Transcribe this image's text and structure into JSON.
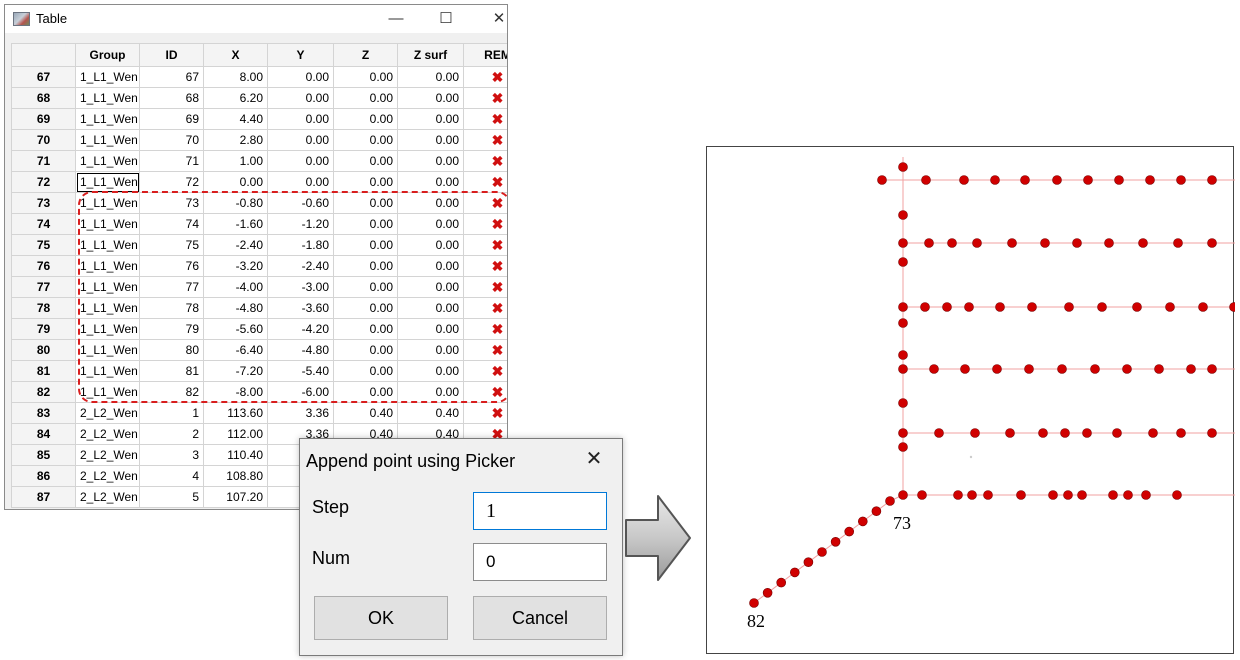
{
  "window": {
    "title": "Table",
    "minimize_glyph": "—",
    "maximize_glyph": "☐",
    "close_glyph": "✕",
    "icon": "app-icon"
  },
  "table": {
    "columns": [
      "",
      "Group",
      "ID",
      "X",
      "Y",
      "Z",
      "Z surf",
      "REM"
    ],
    "rows": [
      {
        "row": "67",
        "group": "1_L1_Wen",
        "id": "67",
        "x": "8.00",
        "y": "0.00",
        "z": "0.00",
        "zsurf": "0.00",
        "rem": "✖"
      },
      {
        "row": "68",
        "group": "1_L1_Wen",
        "id": "68",
        "x": "6.20",
        "y": "0.00",
        "z": "0.00",
        "zsurf": "0.00",
        "rem": "✖"
      },
      {
        "row": "69",
        "group": "1_L1_Wen",
        "id": "69",
        "x": "4.40",
        "y": "0.00",
        "z": "0.00",
        "zsurf": "0.00",
        "rem": "✖"
      },
      {
        "row": "70",
        "group": "1_L1_Wen",
        "id": "70",
        "x": "2.80",
        "y": "0.00",
        "z": "0.00",
        "zsurf": "0.00",
        "rem": "✖"
      },
      {
        "row": "71",
        "group": "1_L1_Wen",
        "id": "71",
        "x": "1.00",
        "y": "0.00",
        "z": "0.00",
        "zsurf": "0.00",
        "rem": "✖"
      },
      {
        "row": "72",
        "group": "1_L1_Wen",
        "id": "72",
        "x": "0.00",
        "y": "0.00",
        "z": "0.00",
        "zsurf": "0.00",
        "rem": "✖"
      },
      {
        "row": "73",
        "group": "1_L1_Wen",
        "id": "73",
        "x": "-0.80",
        "y": "-0.60",
        "z": "0.00",
        "zsurf": "0.00",
        "rem": "✖"
      },
      {
        "row": "74",
        "group": "1_L1_Wen",
        "id": "74",
        "x": "-1.60",
        "y": "-1.20",
        "z": "0.00",
        "zsurf": "0.00",
        "rem": "✖"
      },
      {
        "row": "75",
        "group": "1_L1_Wen",
        "id": "75",
        "x": "-2.40",
        "y": "-1.80",
        "z": "0.00",
        "zsurf": "0.00",
        "rem": "✖"
      },
      {
        "row": "76",
        "group": "1_L1_Wen",
        "id": "76",
        "x": "-3.20",
        "y": "-2.40",
        "z": "0.00",
        "zsurf": "0.00",
        "rem": "✖"
      },
      {
        "row": "77",
        "group": "1_L1_Wen",
        "id": "77",
        "x": "-4.00",
        "y": "-3.00",
        "z": "0.00",
        "zsurf": "0.00",
        "rem": "✖"
      },
      {
        "row": "78",
        "group": "1_L1_Wen",
        "id": "78",
        "x": "-4.80",
        "y": "-3.60",
        "z": "0.00",
        "zsurf": "0.00",
        "rem": "✖"
      },
      {
        "row": "79",
        "group": "1_L1_Wen",
        "id": "79",
        "x": "-5.60",
        "y": "-4.20",
        "z": "0.00",
        "zsurf": "0.00",
        "rem": "✖"
      },
      {
        "row": "80",
        "group": "1_L1_Wen",
        "id": "80",
        "x": "-6.40",
        "y": "-4.80",
        "z": "0.00",
        "zsurf": "0.00",
        "rem": "✖"
      },
      {
        "row": "81",
        "group": "1_L1_Wen",
        "id": "81",
        "x": "-7.20",
        "y": "-5.40",
        "z": "0.00",
        "zsurf": "0.00",
        "rem": "✖"
      },
      {
        "row": "82",
        "group": "1_L1_Wen",
        "id": "82",
        "x": "-8.00",
        "y": "-6.00",
        "z": "0.00",
        "zsurf": "0.00",
        "rem": "✖"
      },
      {
        "row": "83",
        "group": "2_L2_Wen",
        "id": "1",
        "x": "113.60",
        "y": "3.36",
        "z": "0.40",
        "zsurf": "0.40",
        "rem": "✖"
      },
      {
        "row": "84",
        "group": "2_L2_Wen",
        "id": "2",
        "x": "112.00",
        "y": "3.36",
        "z": "0.40",
        "zsurf": "0.40",
        "rem": "✖"
      },
      {
        "row": "85",
        "group": "2_L2_Wen",
        "id": "3",
        "x": "110.40",
        "y": "",
        "z": "",
        "zsurf": "",
        "rem": ""
      },
      {
        "row": "86",
        "group": "2_L2_Wen",
        "id": "4",
        "x": "108.80",
        "y": "",
        "z": "",
        "zsurf": "",
        "rem": ""
      },
      {
        "row": "87",
        "group": "2_L2_Wen",
        "id": "5",
        "x": "107.20",
        "y": "",
        "z": "",
        "zsurf": "",
        "rem": ""
      }
    ],
    "rem_color": "#d01010",
    "selection_color": "#d81e1e"
  },
  "dialog": {
    "title": "Append point using Picker",
    "close_glyph": "✕",
    "step_label": "Step",
    "step_value": "1",
    "num_label": "Num",
    "num_value": "0",
    "ok_label": "OK",
    "cancel_label": "Cancel"
  },
  "plot": {
    "label_start": "73",
    "label_end": "82",
    "point_color": "#d00000",
    "line_color": "#f2a0a0"
  }
}
